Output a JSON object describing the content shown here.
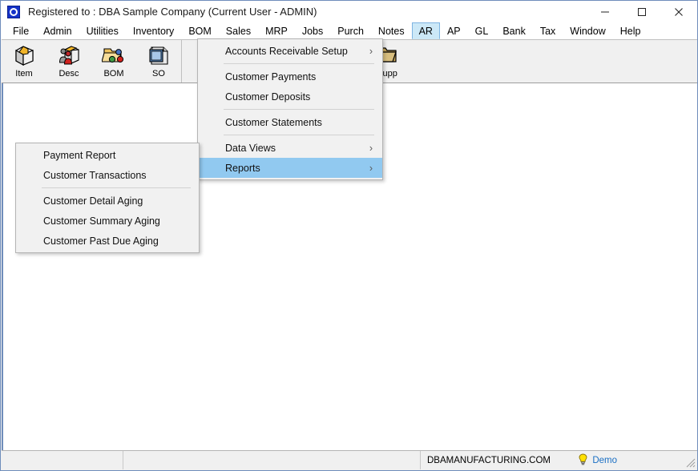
{
  "window": {
    "title": "Registered to : DBA Sample Company (Current User - ADMIN)",
    "app_icon": "app-logo-icon",
    "controls": {
      "minimize": "minimize-icon",
      "maximize": "maximize-icon",
      "close": "close-icon"
    }
  },
  "menubar": {
    "items": [
      {
        "label": "File",
        "active": false
      },
      {
        "label": "Admin",
        "active": false
      },
      {
        "label": "Utilities",
        "active": false
      },
      {
        "label": "Inventory",
        "active": false
      },
      {
        "label": "BOM",
        "active": false
      },
      {
        "label": "Sales",
        "active": false
      },
      {
        "label": "MRP",
        "active": false
      },
      {
        "label": "Jobs",
        "active": false
      },
      {
        "label": "Purch",
        "active": false
      },
      {
        "label": "Notes",
        "active": false
      },
      {
        "label": "AR",
        "active": true
      },
      {
        "label": "AP",
        "active": false
      },
      {
        "label": "GL",
        "active": false
      },
      {
        "label": "Bank",
        "active": false
      },
      {
        "label": "Tax",
        "active": false
      },
      {
        "label": "Window",
        "active": false
      },
      {
        "label": "Help",
        "active": false
      }
    ]
  },
  "toolbar": {
    "group_left": [
      {
        "label": "Item",
        "icon": "item-box-icon"
      },
      {
        "label": "Desc",
        "icon": "descriptors-people-icon"
      },
      {
        "label": "BOM",
        "icon": "bom-folder-icon"
      },
      {
        "label": "SO",
        "icon": "sales-order-notepad-icon"
      }
    ],
    "group_right": [
      {
        "label": "Supp",
        "icon": "supplier-folder-icon"
      }
    ]
  },
  "menu_ar": {
    "items": [
      {
        "label": "Accounts Receivable Setup",
        "submenu": true,
        "selected": false,
        "separator_after": true
      },
      {
        "label": "Customer Payments",
        "submenu": false,
        "selected": false,
        "separator_after": false
      },
      {
        "label": "Customer Deposits",
        "submenu": false,
        "selected": false,
        "separator_after": true
      },
      {
        "label": "Customer Statements",
        "submenu": false,
        "selected": false,
        "separator_after": true
      },
      {
        "label": "Data Views",
        "submenu": true,
        "selected": false,
        "separator_after": false
      },
      {
        "label": "Reports",
        "submenu": true,
        "selected": true,
        "separator_after": false
      }
    ]
  },
  "menu_reports": {
    "items": [
      {
        "label": "Payment Report",
        "separator_after": false
      },
      {
        "label": "Customer Transactions",
        "separator_after": true
      },
      {
        "label": "Customer Detail Aging",
        "separator_after": false
      },
      {
        "label": "Customer Summary Aging",
        "separator_after": false
      },
      {
        "label": "Customer Past Due Aging",
        "separator_after": false
      }
    ]
  },
  "statusbar": {
    "panel1": "",
    "panel2": "",
    "site": "DBAMANUFACTURING.COM",
    "demo_label": "Demo",
    "demo_icon": "lightbulb-icon"
  },
  "colors": {
    "menu_highlight": "#91c9f0",
    "menubar_active": "#cce8f7",
    "window_border": "#6f8dbb",
    "demo_text": "#1a6fc4",
    "chrome": "#f0f0f0"
  }
}
